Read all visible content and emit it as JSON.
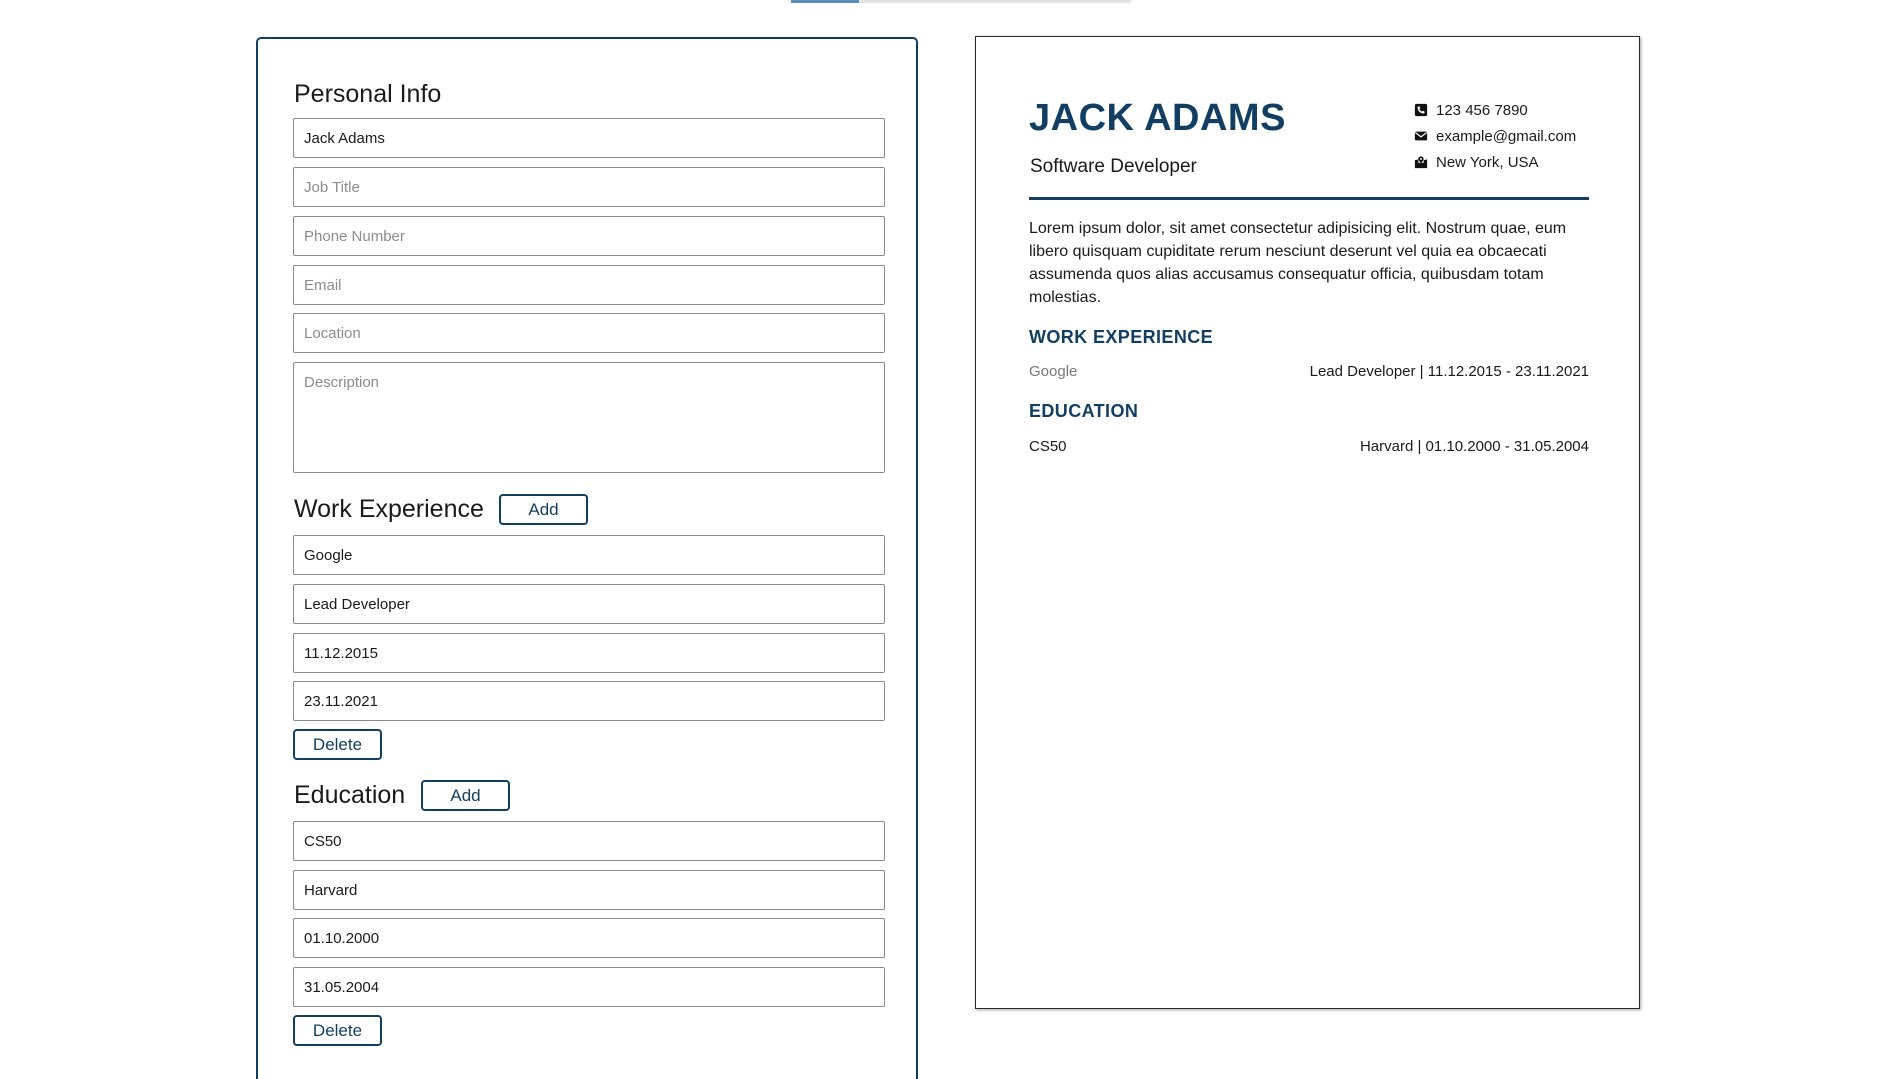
{
  "editor": {
    "personal": {
      "title": "Personal Info",
      "name_value": "Jack Adams",
      "job_title_placeholder": "Job Title",
      "phone_placeholder": "Phone Number",
      "email_placeholder": "Email",
      "location_placeholder": "Location",
      "description_placeholder": "Description"
    },
    "work": {
      "title": "Work Experience",
      "add_label": "Add",
      "company_value": "Google",
      "position_value": "Lead Developer",
      "start_value": "11.12.2015",
      "end_value": "23.11.2021",
      "delete_label": "Delete"
    },
    "education": {
      "title": "Education",
      "add_label": "Add",
      "course_value": "CS50",
      "school_value": "Harvard",
      "start_value": "01.10.2000",
      "end_value": "31.05.2004",
      "delete_label": "Delete"
    }
  },
  "resume": {
    "name": "JACK ADAMS",
    "job_title": "Software Developer",
    "phone": "123 456 7890",
    "email": "example@gmail.com",
    "location": "New York, USA",
    "description": "Lorem ipsum dolor, sit amet consectetur adipisicing elit. Nostrum quae, eum libero quisquam cupiditate rerum nesciunt deserunt vel quia ea obcaecati assumenda quos alias accusamus consequatur officia, quibusdam totam molestias.",
    "work_heading": "WORK EXPERIENCE",
    "work_company": "Google",
    "work_detail": "Lead Developer | 11.12.2015 - 23.11.2021",
    "education_heading": "EDUCATION",
    "education_course": "CS50",
    "education_detail": "Harvard | 01.10.2000 - 31.05.2004"
  },
  "colors": {
    "accent": "#123f61",
    "border": "#8a8a8a",
    "placeholder": "#8c8c8c"
  },
  "icons": [
    "phone-icon",
    "envelope-icon",
    "map-location-icon"
  ]
}
